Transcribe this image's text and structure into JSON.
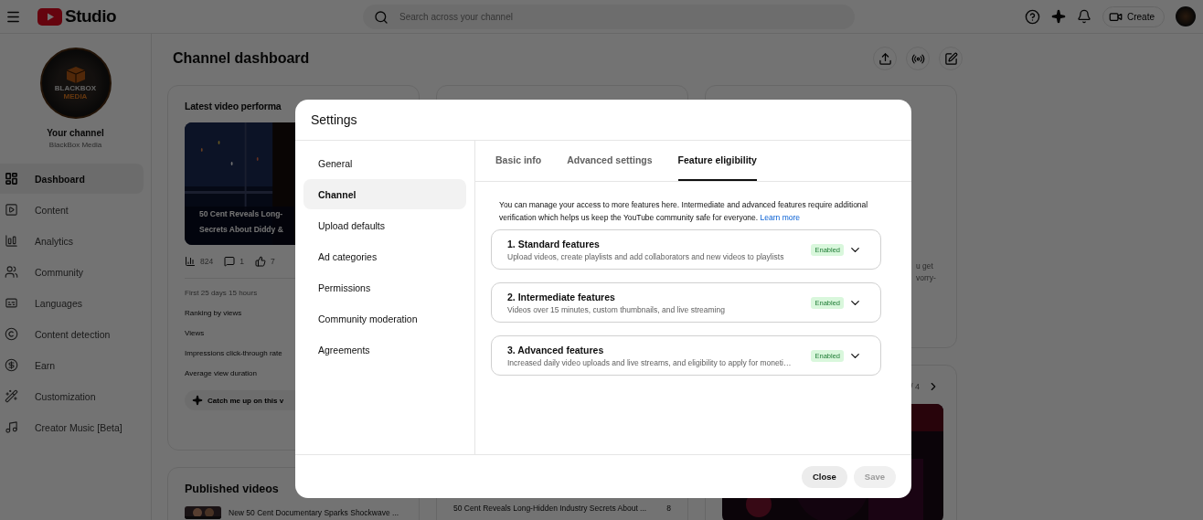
{
  "header": {
    "logo_text": "Studio",
    "search": {
      "placeholder": "Search across your channel"
    },
    "create_label": "Create"
  },
  "sidebar": {
    "logo_lines": [
      "BLACKBOX",
      "MEDIA"
    ],
    "channel_title": "Your channel",
    "channel_name": "BlackBox Media",
    "items": [
      {
        "label": "Dashboard",
        "kind": "dashboard",
        "selected": true
      },
      {
        "label": "Content",
        "kind": "content",
        "selected": false
      },
      {
        "label": "Analytics",
        "kind": "analytics",
        "selected": false
      },
      {
        "label": "Community",
        "kind": "community",
        "selected": false
      },
      {
        "label": "Languages",
        "kind": "languages",
        "selected": false
      },
      {
        "label": "Content detection",
        "kind": "detection",
        "selected": false
      },
      {
        "label": "Earn",
        "kind": "earn",
        "selected": false
      },
      {
        "label": "Customization",
        "kind": "customization",
        "selected": false
      },
      {
        "label": "Creator Music [Beta]",
        "kind": "music",
        "selected": false
      }
    ]
  },
  "dashboard": {
    "title": "Channel dashboard",
    "latest": {
      "title": "Latest video performa",
      "caption_lines": [
        "50 Cent Reveals Long-",
        "Secrets About Diddy &"
      ],
      "stats": [
        {
          "kind": "views",
          "value": "824"
        },
        {
          "kind": "comments",
          "value": "1"
        },
        {
          "kind": "likes",
          "value": "7"
        }
      ],
      "period": "First 25 days 15 hours",
      "metrics": [
        "Ranking by views",
        "Views",
        "Impressions click-through rate",
        "Average view duration"
      ],
      "catch_up": "Catch me up on this v"
    },
    "published": {
      "title": "Published videos",
      "video_title": "New 50 Cent Documentary Sparks Shockwave ..."
    },
    "middle_row": {
      "video_title": "50 Cent Reveals Long-Hidden Industry Secrets About ...",
      "count": "8"
    },
    "side_text_lines": [
      "u get",
      "vorry-"
    ],
    "pager": "/ 4"
  },
  "modal": {
    "title": "Settings",
    "nav": [
      {
        "label": "General",
        "selected": false
      },
      {
        "label": "Channel",
        "selected": true
      },
      {
        "label": "Upload defaults",
        "selected": false
      },
      {
        "label": "Ad categories",
        "selected": false
      },
      {
        "label": "Permissions",
        "selected": false
      },
      {
        "label": "Community moderation",
        "selected": false
      },
      {
        "label": "Agreements",
        "selected": false
      }
    ],
    "tabs": [
      {
        "label": "Basic info",
        "selected": false
      },
      {
        "label": "Advanced settings",
        "selected": false
      },
      {
        "label": "Feature eligibility",
        "selected": true
      }
    ],
    "description": "You can manage your access to more features here. Intermediate and advanced features require additional verification which helps us keep the YouTube community safe for everyone.",
    "link": "Learn more",
    "features": [
      {
        "title": "1. Standard features",
        "description": "Upload videos, create playlists and add collaborators and new videos to playlists",
        "status": "Enabled",
        "expanded": false
      },
      {
        "title": "2. Intermediate features",
        "description": "Videos over 15 minutes, custom thumbnails, and live streaming",
        "status": "Enabled",
        "expanded": false
      },
      {
        "title": "3. Advanced features",
        "description": "Increased daily video uploads and live streams, and eligibility to apply for moneti…",
        "status": "Enabled",
        "expanded": false
      }
    ],
    "buttons": [
      {
        "label": "Close",
        "disabled": false
      },
      {
        "label": "Save",
        "disabled": true
      }
    ]
  }
}
